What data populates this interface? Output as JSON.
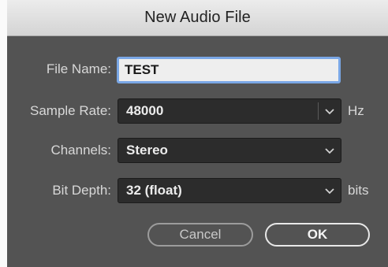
{
  "dialog": {
    "title": "New Audio File"
  },
  "fields": {
    "file_name": {
      "label": "File Name:",
      "value": "TEST"
    },
    "sample_rate": {
      "label": "Sample Rate:",
      "value": "48000",
      "unit": "Hz"
    },
    "channels": {
      "label": "Channels:",
      "value": "Stereo"
    },
    "bit_depth": {
      "label": "Bit Depth:",
      "value": "32 (float)",
      "unit": "bits"
    }
  },
  "buttons": {
    "cancel": "Cancel",
    "ok": "OK"
  },
  "icons": {
    "dropdown": "chevron-down-icon"
  },
  "colors": {
    "dialog_bg": "#535353",
    "focus_ring": "#7aa7e6"
  }
}
